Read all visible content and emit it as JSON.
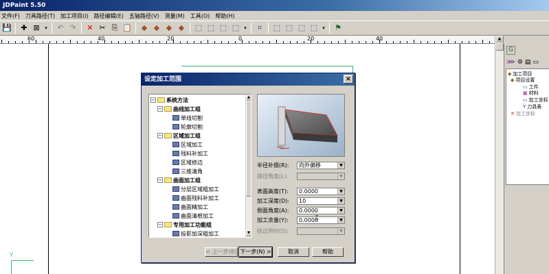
{
  "app": {
    "title": "JDPaint 5.50"
  },
  "menu": [
    "文件(F)",
    "刀具路径(T)",
    "加工项目(I)",
    "路径编辑(E)",
    "五轴路径(V)",
    "测量(M)",
    "工具(O)",
    "帮助(H)"
  ],
  "ruler": {
    "labels": [
      "60",
      "40",
      "20",
      "0",
      "20",
      "40"
    ]
  },
  "right_panel": {
    "tree": [
      "加工项目",
      "项目设置",
      "工件",
      "材料",
      "加工坐标",
      "刀具表",
      "加工坐标"
    ]
  },
  "dialog": {
    "title": "设定加工范围",
    "close": "×",
    "tree": {
      "root": "系统方法",
      "groups": [
        {
          "label": "曲线加工组",
          "items": [
            "单线切割",
            "轮廓切割"
          ]
        },
        {
          "label": "区域加工组",
          "items": [
            "区域加工",
            "残料补加工",
            "区域修边",
            "三维清角"
          ]
        },
        {
          "label": "曲面加工组",
          "items": [
            "分层区域粗加工",
            "曲面残料补加工",
            "曲面精加工",
            "曲面清根加工"
          ]
        },
        {
          "label": "专用加工功能组",
          "items": [
            "投影加深粗加工"
          ]
        }
      ]
    },
    "fields": {
      "radius_comp_label": "半径补偿(R):",
      "radius_comp_value": "向外偏移",
      "path_angle_label": "路径角度(L):",
      "surface_height_label": "表面高度(T):",
      "surface_height_value": "0.0000",
      "depth_label": "加工深度(D):",
      "depth_value": "10",
      "side_angle_label": "侧面角度(A):",
      "side_angle_value": "0.0000",
      "allowance_label": "加工余量(Y):",
      "allowance_value": "0.0000",
      "boundary_label": "抚边界时(S):"
    },
    "buttons": {
      "prev": "< 上一步(B)",
      "next": "下一步(N) >",
      "cancel": "取消",
      "help": "帮助"
    }
  }
}
